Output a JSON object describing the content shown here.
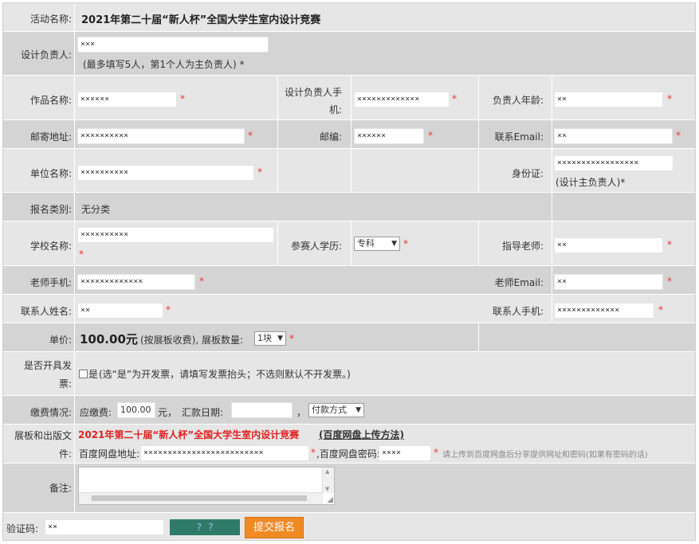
{
  "activity": {
    "label": "活动名称:",
    "value": "2021年第二十届“新人杯”全国大学生室内设计竞赛"
  },
  "leader": {
    "label": "设计负责人:",
    "value": "×××",
    "hint": "(最多填写5人，第1个人为主负责人)"
  },
  "work": {
    "label": "作品名称:",
    "value": "××××××"
  },
  "phone": {
    "label1": "设计负责人手",
    "label2": "机:",
    "value": "×××××××××××××"
  },
  "age": {
    "label": "负责人年龄:",
    "value": "××"
  },
  "address": {
    "label": "邮寄地址:",
    "value": "××××××××××"
  },
  "zip": {
    "label": "邮编:",
    "value": "××××××"
  },
  "email": {
    "label": "联系Email:",
    "value": "××"
  },
  "unit": {
    "label": "单位名称:",
    "value": "××××××××××"
  },
  "idcard": {
    "label": "身份证:",
    "value": "×××××××××××××××××",
    "hint": "(设计主负责人)"
  },
  "category": {
    "label": "报名类别:",
    "value": "无分类"
  },
  "school": {
    "label": "学校名称:",
    "value": "××××××××××"
  },
  "education": {
    "label": "参赛人学历:",
    "value": "专科"
  },
  "advisor": {
    "label": "指导老师:",
    "value": "××"
  },
  "advisor_phone": {
    "label": "老师手机:",
    "value": "×××××××××××××"
  },
  "advisor_email": {
    "label": "老师Email:",
    "value": "××"
  },
  "contact_name": {
    "label": "联系人姓名:",
    "value": "××"
  },
  "contact_phone": {
    "label": "联系人手机:",
    "value": "×××××××××××××"
  },
  "price": {
    "label": "单价:",
    "amount": "100.00元",
    "note": "(按展板收费), 展板数量:",
    "qty": "1块"
  },
  "invoice": {
    "label1": "是否开具发",
    "label2": "票:",
    "option": "是",
    "hint": "(选“是”为开发票，请填写发票抬头；不选则默认不开发票。)"
  },
  "payment": {
    "label": "缴费情况:",
    "due_label": "应缴费:",
    "due": "100.00",
    "unit": "元，",
    "date_label": "汇款日期:",
    "comma": "，",
    "method": "付款方式"
  },
  "files": {
    "label1": "展板和出版文",
    "label2": "件:",
    "title": "2021年第二十届“新人杯”全国大学生室内设计竞赛",
    "link": "(百度网盘上传方法)",
    "url_label": "百度网盘地址:",
    "url": "×××××××××××××××××××××××××",
    "pwd_label": ",百度网盘密码:",
    "pwd": "××××",
    "hint": "请上传到百度网盘后分享提供网址和密码(如果有密码的话)"
  },
  "remark": {
    "label": "备注:"
  },
  "captcha": {
    "label": "验证码:",
    "value": "××",
    "image_text": "? ?"
  },
  "submit": {
    "label": "提交报名"
  },
  "star": "*"
}
